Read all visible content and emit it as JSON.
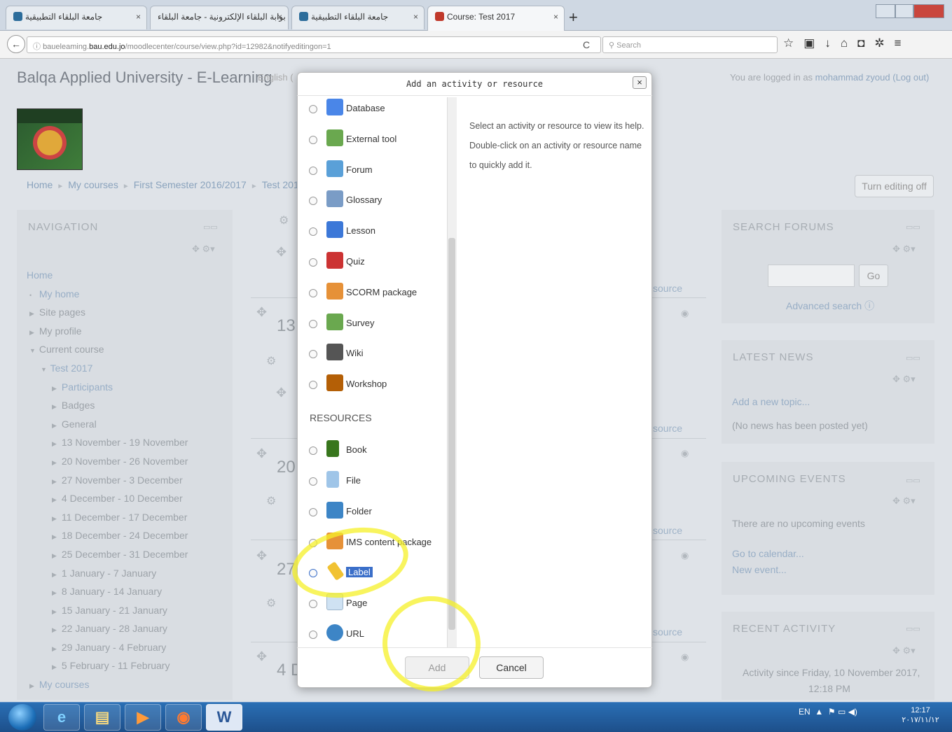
{
  "browser": {
    "tabs": [
      {
        "label": "جامعة البلقاء التطبيقية"
      },
      {
        "label": "بوابة البلقاء الإلكترونية - جامعة البلقاء"
      },
      {
        "label": "جامعة البلقاء التطبيقية"
      },
      {
        "label": "Course: Test 2017"
      }
    ],
    "new_tab": "+",
    "url_prefix": "baueleaming.",
    "url_domain": "bau.edu.jo",
    "url_path": "/moodlecenter/course/view.php?id=12982&notifyeditingon=1",
    "search_placeholder": "Search"
  },
  "site": {
    "title": "Balqa Applied University - E-Learning",
    "lang": "English (",
    "logged_prefix": "You are logged in as ",
    "user": "mohammad zyoud",
    "logout": "(Log out)"
  },
  "breadcrumb": {
    "items": [
      "Home",
      "My courses",
      "First Semester 2016/2017",
      "Test 201"
    ]
  },
  "turn_editing_off": "Turn editing off",
  "navigation": {
    "title": "NAVIGATION",
    "items": [
      {
        "label": "Home"
      },
      {
        "label": "My home"
      },
      {
        "label": "Site pages"
      },
      {
        "label": "My profile"
      },
      {
        "label": "Current course"
      },
      {
        "label": "Test 2017"
      },
      {
        "label": "Participants"
      },
      {
        "label": "Badges"
      },
      {
        "label": "General"
      },
      {
        "label": "13 November - 19 November"
      },
      {
        "label": "20 November - 26 November"
      },
      {
        "label": "27 November - 3 December"
      },
      {
        "label": "4 December - 10 December"
      },
      {
        "label": "11 December - 17 December"
      },
      {
        "label": "18 December - 24 December"
      },
      {
        "label": "25 December - 31 December"
      },
      {
        "label": "1 January - 7 January"
      },
      {
        "label": "8 January - 14 January"
      },
      {
        "label": "15 January - 21 January"
      },
      {
        "label": "22 January - 28 January"
      },
      {
        "label": "29 January - 4 February"
      },
      {
        "label": "5 February - 11 February"
      },
      {
        "label": "My courses"
      }
    ]
  },
  "course": {
    "sections": [
      {
        "num": "13"
      },
      {
        "num": "20"
      },
      {
        "num": "27"
      },
      {
        "num": "4 D"
      }
    ],
    "add_resource_partial": "source"
  },
  "search_forums": {
    "title": "SEARCH FORUMS",
    "go": "Go",
    "advanced": "Advanced search"
  },
  "latest_news": {
    "title": "LATEST NEWS",
    "add_topic": "Add a new topic...",
    "empty": "(No news has been posted yet)"
  },
  "upcoming_events": {
    "title": "UPCOMING EVENTS",
    "empty": "There are no upcoming events",
    "calendar": "Go to calendar...",
    "new_event": "New event..."
  },
  "recent_activity": {
    "title": "RECENT ACTIVITY",
    "since": "Activity since Friday, 10 November 2017,",
    "time": "12:18 PM"
  },
  "modal": {
    "title": "Add an activity or resource",
    "activities": [
      {
        "label": "Database",
        "icon": "database-icon",
        "color": "#4a86e8"
      },
      {
        "label": "External tool",
        "icon": "puzzle-icon",
        "color": "#6aa84f"
      },
      {
        "label": "Forum",
        "icon": "forum-icon",
        "color": "#5aa0d8"
      },
      {
        "label": "Glossary",
        "icon": "glossary-icon",
        "color": "#7a9cc6"
      },
      {
        "label": "Lesson",
        "icon": "lesson-icon",
        "color": "#3c78d8"
      },
      {
        "label": "Quiz",
        "icon": "quiz-icon",
        "color": "#cc3333"
      },
      {
        "label": "SCORM package",
        "icon": "scorm-icon",
        "color": "#e69138"
      },
      {
        "label": "Survey",
        "icon": "survey-icon",
        "color": "#6aa84f"
      },
      {
        "label": "Wiki",
        "icon": "wiki-icon",
        "color": "#555555"
      },
      {
        "label": "Workshop",
        "icon": "workshop-icon",
        "color": "#b45f06"
      }
    ],
    "resources_heading": "RESOURCES",
    "resources": [
      {
        "label": "Book",
        "icon": "book-icon",
        "color": "#38761d"
      },
      {
        "label": "File",
        "icon": "file-icon",
        "color": "#9fc5e8"
      },
      {
        "label": "Folder",
        "icon": "folder-icon",
        "color": "#3d85c6"
      },
      {
        "label": "IMS content package",
        "icon": "ims-icon",
        "color": "#e69138"
      },
      {
        "label": "Label",
        "icon": "label-icon",
        "color": "#f1c232"
      },
      {
        "label": "Page",
        "icon": "page-icon",
        "color": "#cfe2f3"
      },
      {
        "label": "URL",
        "icon": "url-icon",
        "color": "#3d85c6"
      }
    ],
    "selected": "Label",
    "help": "Select an activity or resource to view its help. Double-click on an activity or resource name to quickly add it.",
    "add": "Add",
    "cancel": "Cancel"
  },
  "taskbar": {
    "apps": [
      "e",
      "▤",
      "▶",
      "◉",
      "W"
    ],
    "lang": "EN",
    "time": "12:17",
    "date": "٢٠١٧/١١/١٢"
  }
}
